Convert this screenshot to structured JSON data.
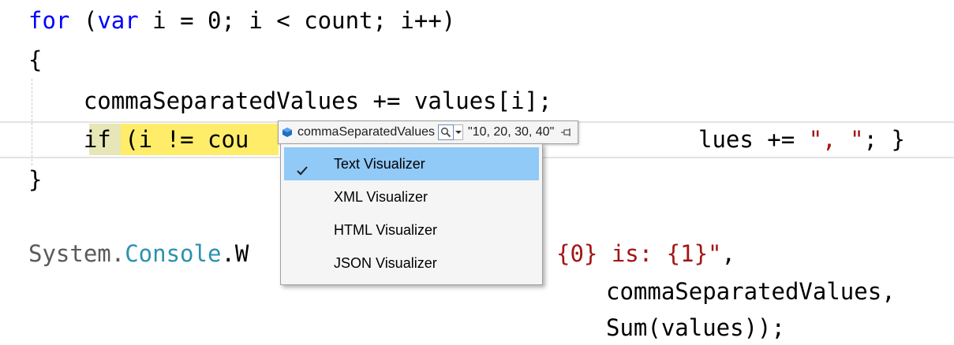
{
  "code": {
    "line1": {
      "kw1": "for",
      "p1": " (",
      "kw2": "var",
      "rest": " i = 0; i < count; i++)"
    },
    "line2": "{",
    "line3": "    commaSeparatedValues += values[i];",
    "line4": {
      "indent": "    ",
      "kw_if": "if",
      "visible_start": " (i != cou",
      "visible_end": "lues += ",
      "str": "\", \"",
      "tail": "; }"
    },
    "line5": "}",
    "line6": {
      "ns": "System.",
      "type": "Console",
      "dot_w": ".W",
      "str": "{0} is: {1}\"",
      "comma": ","
    },
    "line7": "commaSeparatedValues,",
    "line8": "Sum(values));"
  },
  "datatip": {
    "variable": "commaSeparatedValues",
    "value": "\"10, 20, 30, 40\"",
    "icons": [
      "field-icon",
      "magnifier-icon",
      "dropdown-arrow-icon",
      "pin-icon"
    ]
  },
  "menu": {
    "items": [
      {
        "label": "Text Visualizer",
        "checked": true
      },
      {
        "label": "XML Visualizer",
        "checked": false
      },
      {
        "label": "HTML Visualizer",
        "checked": false
      },
      {
        "label": "JSON Visualizer",
        "checked": false
      }
    ]
  },
  "colors": {
    "keyword": "#0000ff",
    "string": "#a31515",
    "type": "#2b91af",
    "highlight": "#ffed6a",
    "selection": "#91c9f7"
  }
}
